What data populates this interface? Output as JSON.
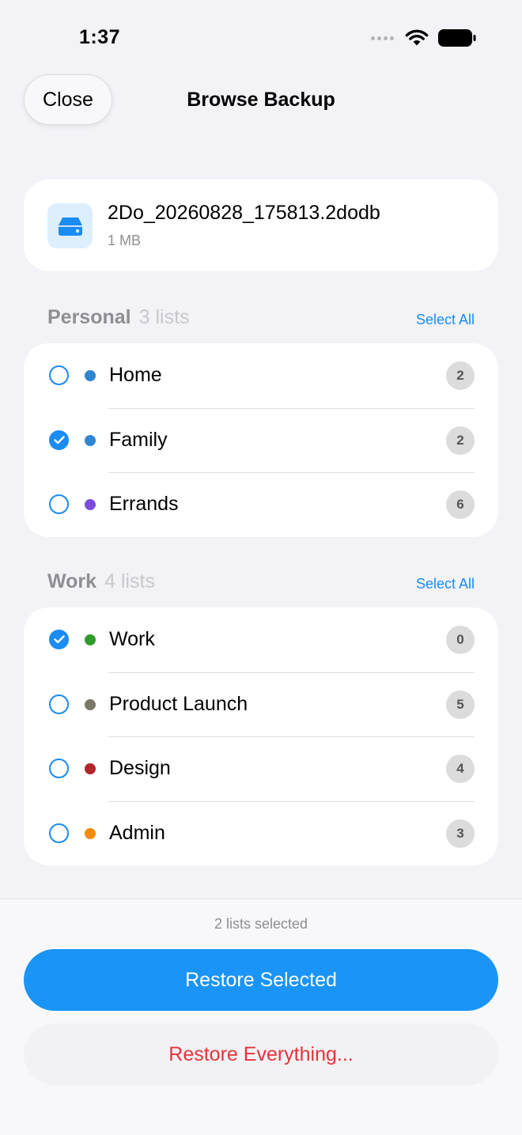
{
  "status_bar": {
    "time": "1:37"
  },
  "nav": {
    "close_label": "Close",
    "title": "Browse Backup"
  },
  "file": {
    "name": "2Do_20260828_175813.2dodb",
    "size": "1 MB",
    "icon": "drive-icon"
  },
  "sections": [
    {
      "title": "Personal",
      "count": "3 lists",
      "select_all": "Select All",
      "items": [
        {
          "label": "Home",
          "color": "#2f86d1",
          "checked": false,
          "count": "2"
        },
        {
          "label": "Family",
          "color": "#2f86d1",
          "checked": true,
          "count": "2"
        },
        {
          "label": "Errands",
          "color": "#7c4ddc",
          "checked": false,
          "count": "6"
        }
      ]
    },
    {
      "title": "Work",
      "count": "4 lists",
      "select_all": "Select All",
      "items": [
        {
          "label": "Work",
          "color": "#2e9c2a",
          "checked": true,
          "count": "0"
        },
        {
          "label": "Product Launch",
          "color": "#7a7868",
          "checked": false,
          "count": "5"
        },
        {
          "label": "Design",
          "color": "#b0262a",
          "checked": false,
          "count": "4"
        },
        {
          "label": "Admin",
          "color": "#f58a0b",
          "checked": false,
          "count": "3"
        }
      ]
    }
  ],
  "footer": {
    "selected_text": "2 lists selected",
    "restore_selected": "Restore Selected",
    "restore_everything": "Restore Everything..."
  },
  "colors": {
    "accent": "#1a94f6",
    "destructive": "#e5333b"
  }
}
